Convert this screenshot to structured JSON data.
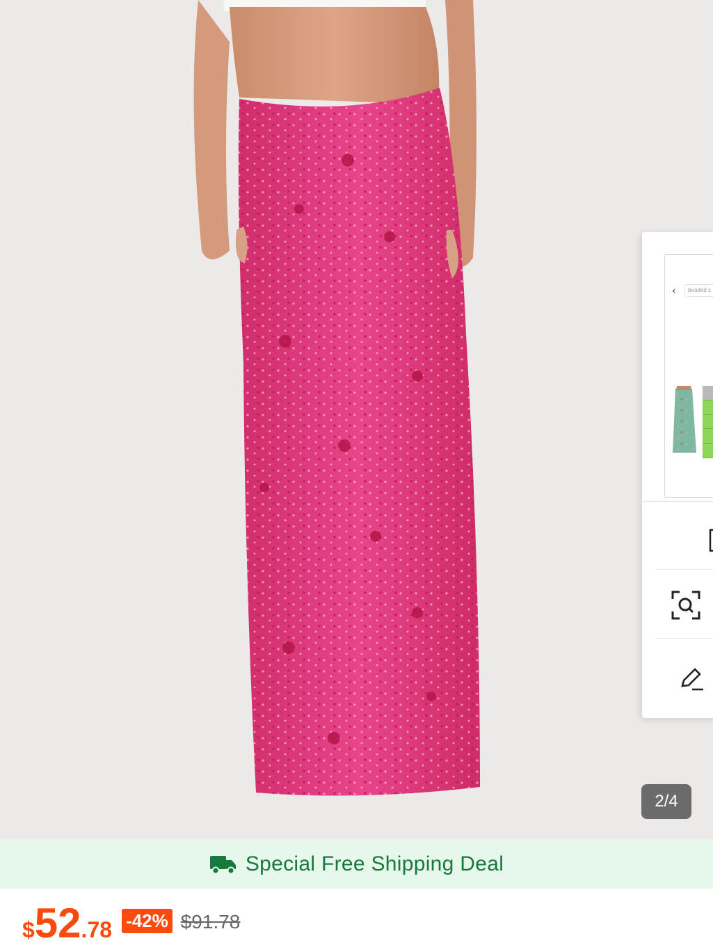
{
  "product": {
    "image_alt": "Pink beaded sequin maxi skirt",
    "image_counter": "2/4"
  },
  "side_panel": {
    "search_text": "beaded s",
    "back_icon": "chevron-left-icon",
    "icons": [
      "square-icon",
      "scan-search-icon",
      "edit-pencil-icon"
    ]
  },
  "shipping": {
    "icon": "truck-icon",
    "text": "Special Free Shipping Deal"
  },
  "pricing": {
    "currency": "$",
    "price_int": "52",
    "price_dec": ".78",
    "discount": "-42%",
    "original_price": "$91.78"
  },
  "colors": {
    "accent": "#fa4a0e",
    "shipping_green": "#177a3c",
    "shipping_bg": "#e6f7ec",
    "skirt_pink": "#e23c7c"
  }
}
